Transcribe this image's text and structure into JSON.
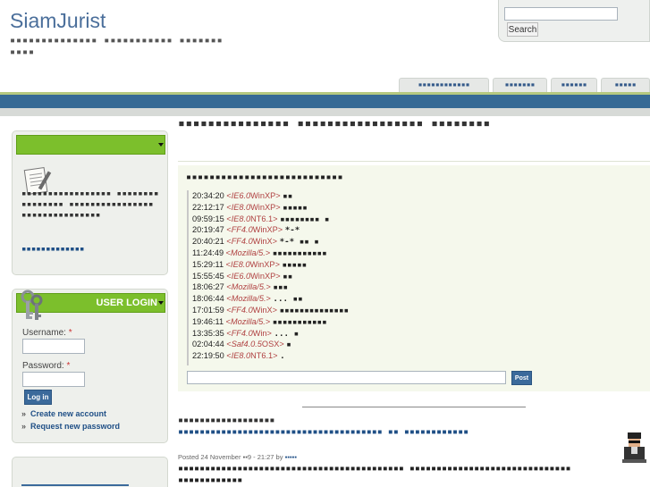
{
  "header": {
    "site_name": "SiamJurist",
    "slogan": "▪▪▪▪▪▪▪▪▪▪▪▪▪▪ ▪▪▪▪▪▪▪▪▪▪▪ ▪▪▪▪▪▪▪▪▪▪▪"
  },
  "search": {
    "button_label": "Search",
    "value": ""
  },
  "tabs": [
    "▪▪▪▪▪▪▪▪▪▪▪▪",
    "▪▪▪▪▪▪▪",
    "▪▪▪▪▪▪",
    "▪▪▪▪▪"
  ],
  "sidebar": {
    "block1": {
      "title": "",
      "text": "▪▪▪▪▪▪▪▪▪▪▪▪▪▪▪▪▪ ▪▪▪▪▪▪▪▪▪▪▪▪▪▪▪▪ ▪▪▪▪▪▪▪▪▪▪▪▪▪▪▪▪ ▪▪▪▪▪▪▪▪▪▪▪▪▪▪▪",
      "link": "▪▪▪▪▪▪▪▪▪▪▪▪▪"
    },
    "login": {
      "title": "USER LOGIN",
      "username_label": "Username:",
      "password_label": "Password:",
      "required_mark": "*",
      "button_label": "Log in",
      "create_account": "Create new account",
      "request_password": "Request new password",
      "bullet": "»"
    }
  },
  "main": {
    "page_title": "▪▪▪▪▪▪▪▪▪▪▪▪▪▪▪ ▪▪▪▪▪▪▪▪▪▪▪▪▪▪▪▪▪ ▪▪▪▪▪▪▪▪",
    "shoutbox": {
      "title": "▪▪▪▪▪▪▪▪▪▪▪▪▪▪▪▪▪▪▪▪▪▪▪▪▪▪▪",
      "shouts": [
        {
          "time": "20:34:20",
          "agent": "IE6.0",
          "os": "WinXP",
          "msg": "▪▪"
        },
        {
          "time": "22:12:17",
          "agent": "IE8.0",
          "os": "WinXP",
          "msg": "▪▪▪▪▪"
        },
        {
          "time": "09:59:15",
          "agent": "IE8.0",
          "os": "NT6.1",
          "msg": "▪▪▪▪▪▪▪▪ ▪"
        },
        {
          "time": "20:19:47",
          "agent": "FF4.0",
          "os": "WinXP",
          "msg": "*-*"
        },
        {
          "time": "20:40:21",
          "agent": "FF4.0",
          "os": "WinX",
          "msg": "*-* ▪▪ ▪"
        },
        {
          "time": "11:24:49",
          "agent": "Mozilla/5.",
          "os": "",
          "msg": "▪▪▪▪▪▪▪▪▪▪▪"
        },
        {
          "time": "15:29:11",
          "agent": "IE8.0",
          "os": "WinXP",
          "msg": "▪▪▪▪▪"
        },
        {
          "time": "15:55:45",
          "agent": "IE6.0",
          "os": "WinXP",
          "msg": "▪▪"
        },
        {
          "time": "18:06:27",
          "agent": "Mozilla/5.",
          "os": "",
          "msg": "▪▪▪"
        },
        {
          "time": "18:06:44",
          "agent": "Mozilla/5.",
          "os": "",
          "msg": "... ▪▪"
        },
        {
          "time": "17:01:59",
          "agent": "FF4.0",
          "os": "WinX",
          "msg": "▪▪▪▪▪▪▪▪▪▪▪▪▪▪"
        },
        {
          "time": "19:46:11",
          "agent": "Mozilla/5.",
          "os": "",
          "msg": "▪▪▪▪▪▪▪▪▪▪▪"
        },
        {
          "time": "13:35:35",
          "agent": "FF4.0",
          "os": "Win",
          "msg": "... ▪"
        },
        {
          "time": "02:04:44",
          "agent": "Saf4.0.5",
          "os": "OSX",
          "msg": "▪"
        },
        {
          "time": "22:19:50",
          "agent": "IE8.0",
          "os": "NT6.1",
          "msg": "."
        }
      ],
      "post_label": "Post"
    },
    "node": {
      "title": "▪▪▪▪▪▪▪▪▪▪▪▪▪▪▪▪▪▪",
      "link": "▪▪▪▪▪▪▪▪▪▪▪▪▪▪▪▪▪▪▪▪▪▪▪▪▪▪▪▪▪▪▪▪▪▪▪▪▪▪ ▪▪ ▪▪▪▪▪▪▪▪▪▪▪▪",
      "submitted": "Posted 24 November ▪▪9 - 21:27 by",
      "author": "▪▪▪▪▪",
      "body": "▪▪▪▪▪▪▪▪▪▪▪▪▪▪▪▪▪▪▪▪▪▪▪▪▪▪▪▪▪▪▪▪▪▪▪▪▪▪▪▪▪▪ ▪▪▪▪▪▪▪▪▪▪▪▪▪▪▪▪▪▪▪▪▪▪▪▪▪▪▪▪▪▪▪▪▪▪▪▪▪▪▪▪▪▪"
    }
  },
  "colors": {
    "brand_blue": "#366a95",
    "accent_green": "#7cbf2c",
    "link": "#1f4f86",
    "agent_red": "#b04242"
  }
}
